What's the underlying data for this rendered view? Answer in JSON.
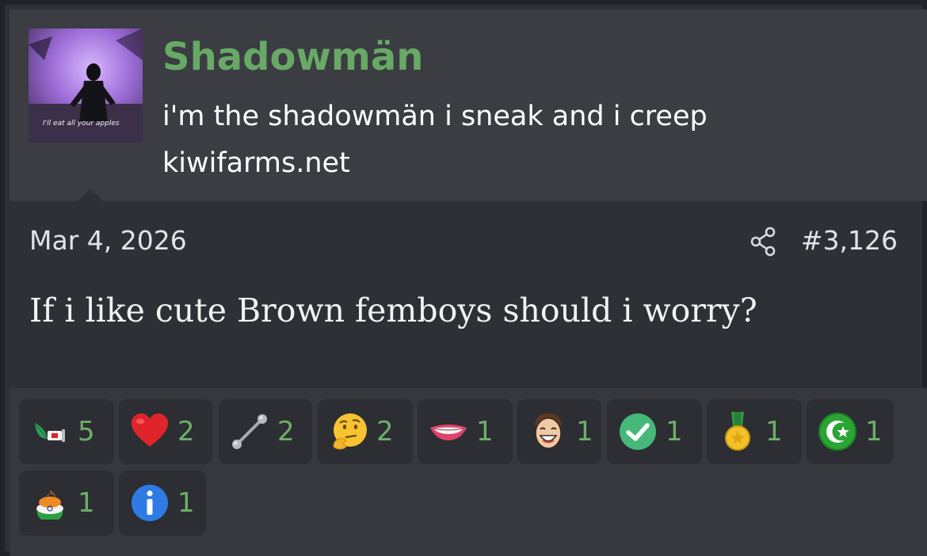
{
  "user": {
    "name": "Shadowmän",
    "title": "i'm the shadowmän i sneak and i creep",
    "site": "kiwifarms.net",
    "avatar_caption": "I'll eat all your apples"
  },
  "post": {
    "date": "Mar 4, 2026",
    "number": "#3,126",
    "body": "If i like cute Brown femboys should i worry?"
  },
  "reactions": [
    {
      "icon": "leaf-flag-icon",
      "count": "5"
    },
    {
      "icon": "heart-icon",
      "count": "2"
    },
    {
      "icon": "barbell-icon",
      "count": "2"
    },
    {
      "icon": "thinking-face-icon",
      "count": "2"
    },
    {
      "icon": "lips-icon",
      "count": "1"
    },
    {
      "icon": "laughing-man-icon",
      "count": "1"
    },
    {
      "icon": "checkmark-icon",
      "count": "1"
    },
    {
      "icon": "medal-icon",
      "count": "1"
    },
    {
      "icon": "crescent-star-icon",
      "count": "1"
    },
    {
      "icon": "poop-flag-icon",
      "count": "1"
    },
    {
      "icon": "info-icon",
      "count": "1"
    }
  ],
  "colors": {
    "username": "#67a965",
    "reaction_count": "#6fae6a",
    "header_bg": "#3b3d43",
    "body_bg": "#2e3035"
  }
}
